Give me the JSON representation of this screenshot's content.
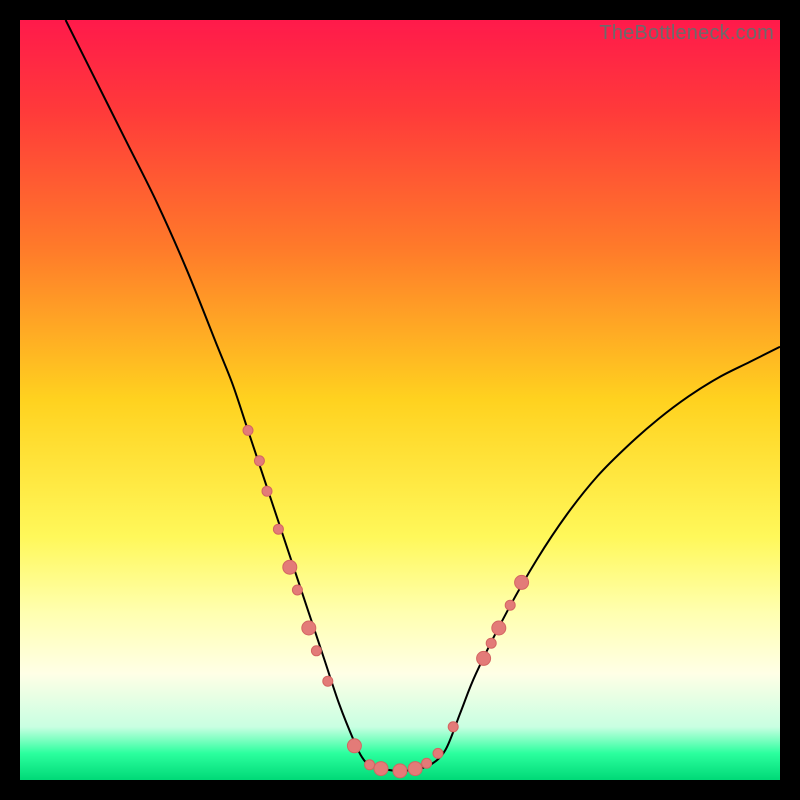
{
  "watermark": "TheBottleneck.com",
  "chart_data": {
    "type": "line",
    "title": "",
    "xlabel": "",
    "ylabel": "",
    "xlim": [
      0,
      100
    ],
    "ylim": [
      0,
      100
    ],
    "grid": false,
    "legend": false,
    "gradient_stops": [
      {
        "offset": 0.0,
        "color": "#ff1a4b"
      },
      {
        "offset": 0.12,
        "color": "#ff3a3a"
      },
      {
        "offset": 0.3,
        "color": "#ff7a2a"
      },
      {
        "offset": 0.5,
        "color": "#ffd21f"
      },
      {
        "offset": 0.68,
        "color": "#fff85a"
      },
      {
        "offset": 0.78,
        "color": "#ffffb0"
      },
      {
        "offset": 0.86,
        "color": "#ffffe6"
      },
      {
        "offset": 0.93,
        "color": "#c9ffe2"
      },
      {
        "offset": 0.965,
        "color": "#2bff9e"
      },
      {
        "offset": 1.0,
        "color": "#00d977"
      }
    ],
    "series": [
      {
        "name": "bottleneck-curve",
        "stroke": "#000000",
        "stroke_width": 2,
        "x": [
          6,
          10,
          14,
          18,
          22,
          26,
          28,
          30,
          32,
          34,
          36,
          38,
          40,
          42,
          44,
          45,
          46,
          48,
          50,
          52,
          54,
          56,
          58,
          60,
          64,
          68,
          72,
          76,
          80,
          84,
          88,
          92,
          96,
          100
        ],
        "y": [
          100,
          92,
          84,
          76,
          67,
          57,
          52,
          46,
          40,
          34,
          28,
          22,
          16,
          10,
          5,
          3,
          2,
          1.4,
          1.2,
          1.4,
          2,
          4,
          9,
          14,
          22,
          29,
          35,
          40,
          44,
          47.5,
          50.5,
          53,
          55,
          57
        ]
      }
    ],
    "markers": {
      "name": "highlighted-region",
      "fill": "#e37b78",
      "stroke": "#d46562",
      "r_small": 5,
      "r_large": 7,
      "points": [
        {
          "x": 30,
          "y": 46,
          "r": 5
        },
        {
          "x": 31.5,
          "y": 42,
          "r": 5
        },
        {
          "x": 32.5,
          "y": 38,
          "r": 5
        },
        {
          "x": 34,
          "y": 33,
          "r": 5
        },
        {
          "x": 35.5,
          "y": 28,
          "r": 7
        },
        {
          "x": 36.5,
          "y": 25,
          "r": 5
        },
        {
          "x": 38,
          "y": 20,
          "r": 7
        },
        {
          "x": 39,
          "y": 17,
          "r": 5
        },
        {
          "x": 40.5,
          "y": 13,
          "r": 5
        },
        {
          "x": 44,
          "y": 4.5,
          "r": 7
        },
        {
          "x": 46,
          "y": 2,
          "r": 5
        },
        {
          "x": 47.5,
          "y": 1.5,
          "r": 7
        },
        {
          "x": 50,
          "y": 1.2,
          "r": 7
        },
        {
          "x": 52,
          "y": 1.5,
          "r": 7
        },
        {
          "x": 53.5,
          "y": 2.2,
          "r": 5
        },
        {
          "x": 55,
          "y": 3.5,
          "r": 5
        },
        {
          "x": 57,
          "y": 7,
          "r": 5
        },
        {
          "x": 61,
          "y": 16,
          "r": 7
        },
        {
          "x": 62,
          "y": 18,
          "r": 5
        },
        {
          "x": 63,
          "y": 20,
          "r": 7
        },
        {
          "x": 64.5,
          "y": 23,
          "r": 5
        },
        {
          "x": 66,
          "y": 26,
          "r": 7
        }
      ]
    }
  }
}
